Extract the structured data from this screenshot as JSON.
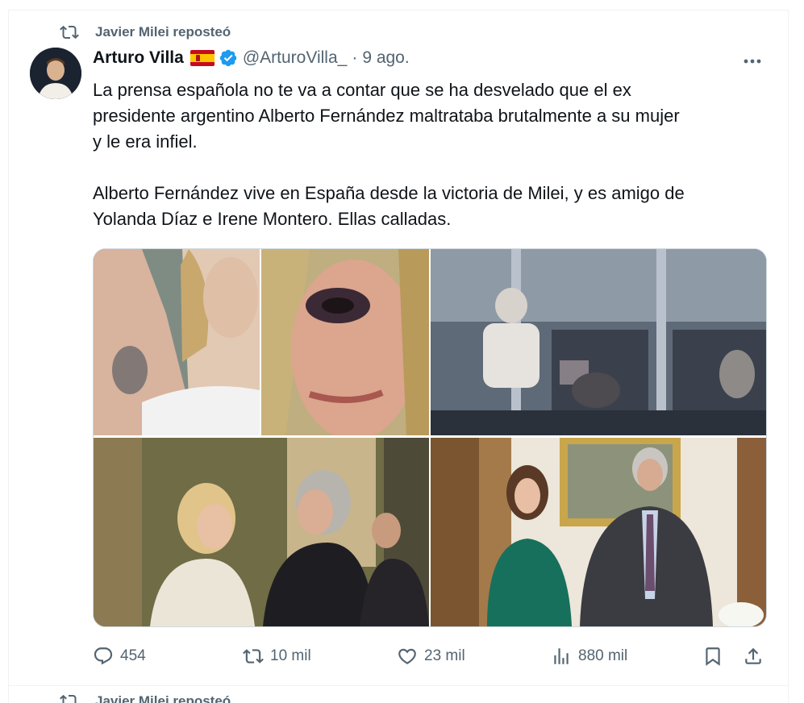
{
  "repost": {
    "label": "Javier Milei reposteó",
    "icon": "repost-icon"
  },
  "tweet": {
    "author_name": "Arturo Villa",
    "author_flag": "spain-flag-emoji",
    "verified": true,
    "handle": "@ArturoVilla_",
    "separator": "·",
    "date": "9 ago.",
    "text_lines_1": [
      "La prensa española no te va a contar que se ha desvelado que el ex",
      "presidente argentino Alberto Fernández maltrataba brutalmente a su mujer",
      "y le era infiel."
    ],
    "text_lines_2": [
      "Alberto Fernández vive en España desde la victoria de Milei, y es amigo de",
      "Yolanda Díaz e Irene Montero. Ellas calladas."
    ],
    "media": [
      "photo-bruised-arm",
      "photo-black-eye",
      "photo-security-camera",
      "photo-yolanda-diaz-alberto-fernandez",
      "photo-irene-montero-alberto-fernandez"
    ]
  },
  "actions": {
    "reply_count": "454",
    "repost_count": "10 mil",
    "like_count": "23 mil",
    "views_count": "880 mil"
  },
  "next_item": {
    "repost_label": "Javier Milei reposteó"
  },
  "colors": {
    "muted": "#536471",
    "text": "#0f1419",
    "verified_blue": "#1d9bf0",
    "border": "#eff3f4"
  }
}
